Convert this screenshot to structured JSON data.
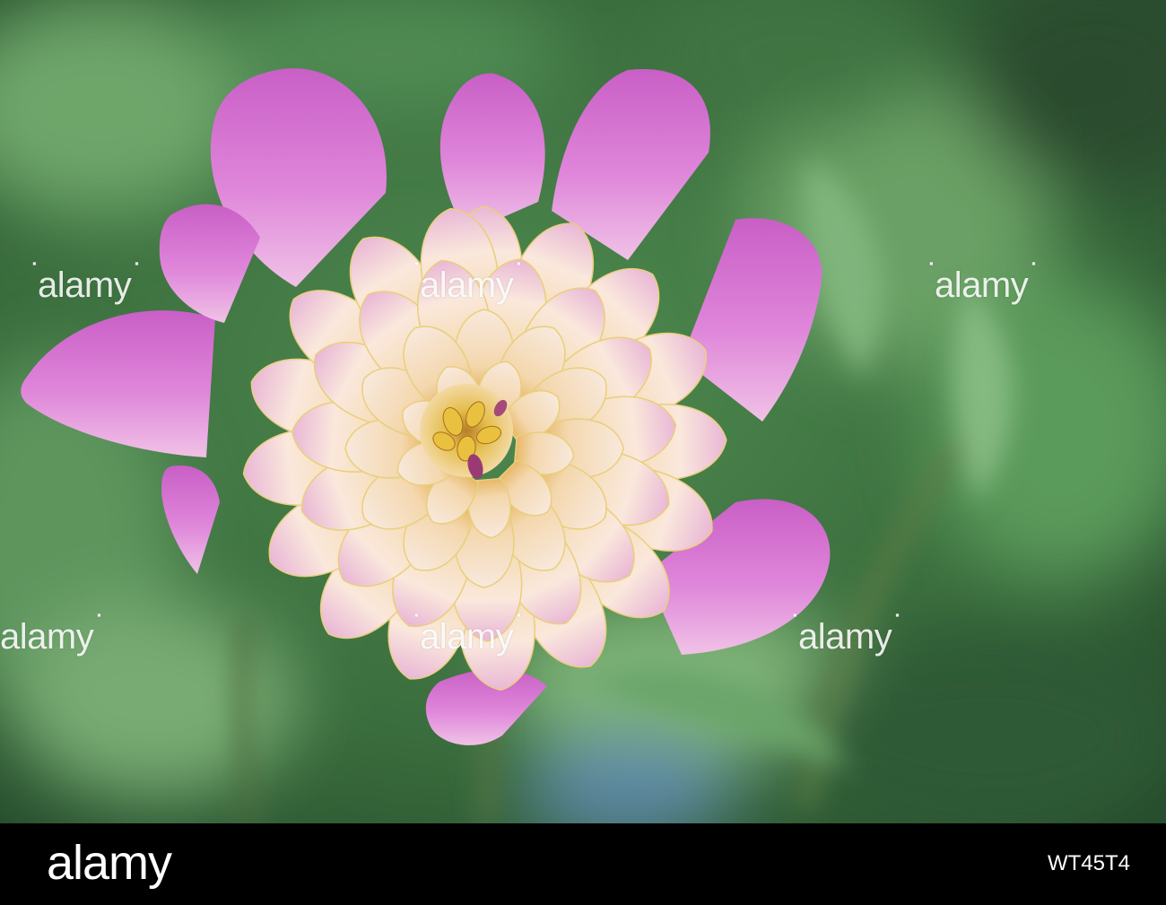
{
  "photo": {
    "subject": "dahlia-flower",
    "colors": {
      "background_green": "#3f7440",
      "leaf_green": "#5f9a63",
      "petal_pink": "#d978d6",
      "petal_cream": "#f6e6d3",
      "center_yellow": "#e6c04a"
    }
  },
  "watermarks": [
    {
      "text": "alamy"
    },
    {
      "text": "alamy"
    },
    {
      "text": "alamy"
    },
    {
      "text": "alamy"
    },
    {
      "text": "alamy"
    },
    {
      "text": "alamy"
    }
  ],
  "footer": {
    "logo": "alamy",
    "image_id": "WT45T4"
  }
}
